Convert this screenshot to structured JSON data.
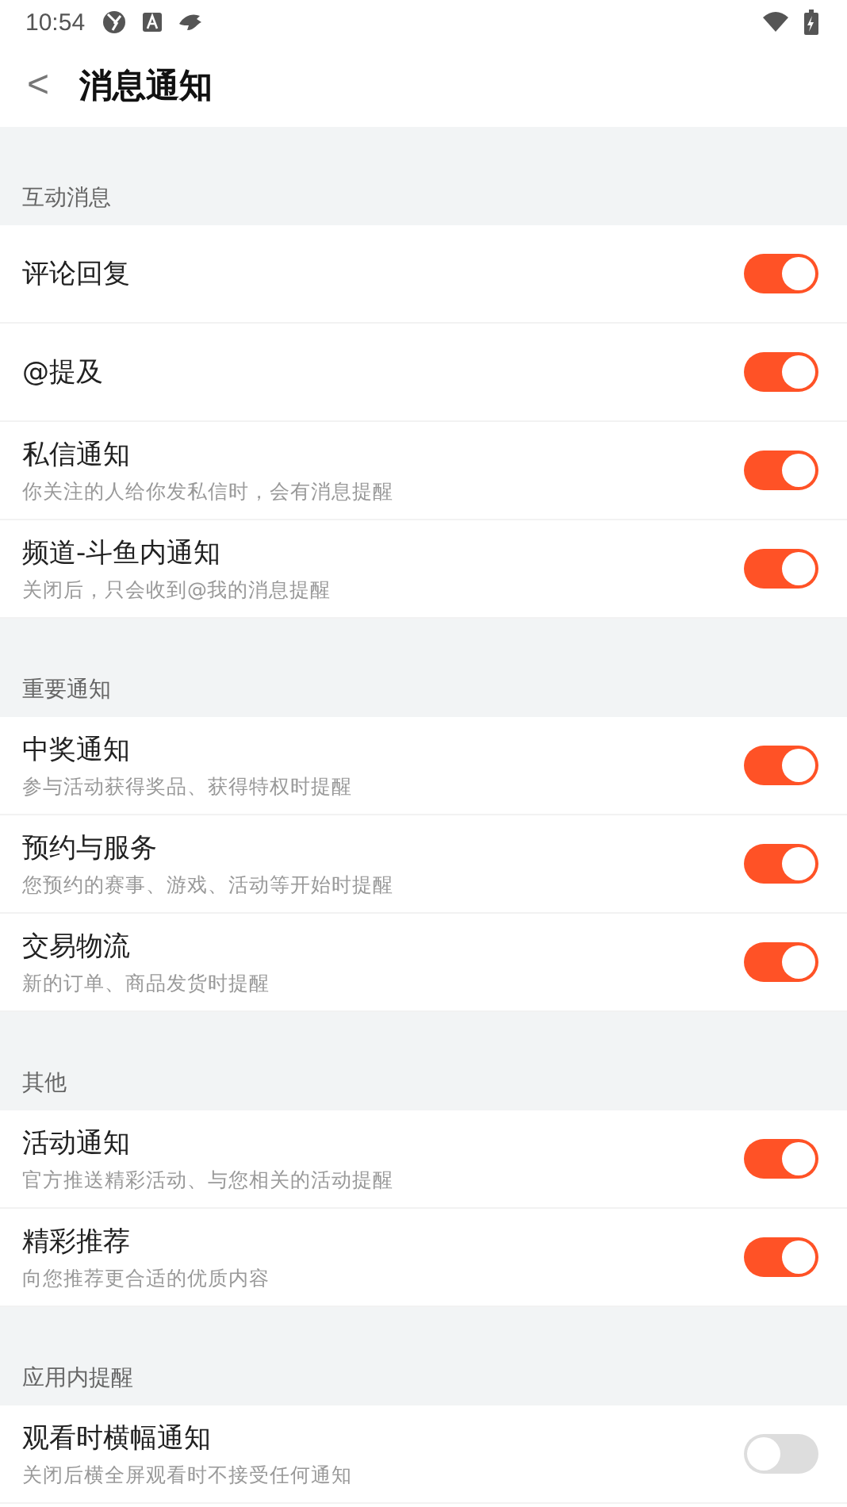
{
  "status_bar": {
    "time": "10:54"
  },
  "header": {
    "back": "<",
    "title": "消息通知"
  },
  "sections": [
    {
      "title": "互动消息",
      "items": [
        {
          "label": "评论回复",
          "on": true
        },
        {
          "label": "@提及",
          "on": true
        },
        {
          "label": "私信通知",
          "desc": "你关注的人给你发私信时，会有消息提醒",
          "on": true
        },
        {
          "label": "频道-斗鱼内通知",
          "desc": "关闭后，只会收到@我的消息提醒",
          "on": true
        }
      ]
    },
    {
      "title": "重要通知",
      "items": [
        {
          "label": "中奖通知",
          "desc": "参与活动获得奖品、获得特权时提醒",
          "on": true
        },
        {
          "label": "预约与服务",
          "desc": "您预约的赛事、游戏、活动等开始时提醒",
          "on": true
        },
        {
          "label": "交易物流",
          "desc": "新的订单、商品发货时提醒",
          "on": true
        }
      ]
    },
    {
      "title": "其他",
      "items": [
        {
          "label": "活动通知",
          "desc": "官方推送精彩活动、与您相关的活动提醒",
          "on": true
        },
        {
          "label": "精彩推荐",
          "desc": "向您推荐更合适的优质内容",
          "on": true
        }
      ]
    },
    {
      "title": "应用内提醒",
      "items": [
        {
          "label": "观看时横幅通知",
          "desc": "关闭后横全屏观看时不接受任何通知",
          "on": false
        }
      ]
    }
  ]
}
